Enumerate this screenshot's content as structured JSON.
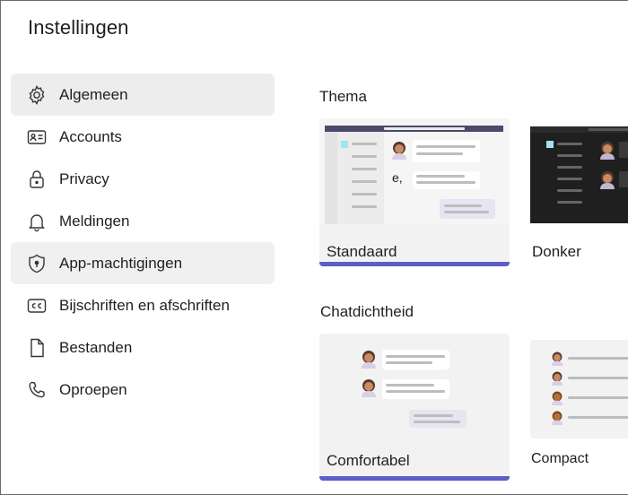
{
  "window": {
    "title": "Instellingen"
  },
  "sidebar": {
    "items": [
      {
        "label": "Algemeen",
        "icon": "gear-icon",
        "state": "selected"
      },
      {
        "label": "Accounts",
        "icon": "id-card-icon"
      },
      {
        "label": "Privacy",
        "icon": "lock-icon"
      },
      {
        "label": "Meldingen",
        "icon": "bell-icon"
      },
      {
        "label": "App-machtigingen",
        "icon": "shield-icon",
        "state": "hover"
      },
      {
        "label": "Bijschriften en afschriften",
        "icon": "closed-captions-icon"
      },
      {
        "label": "Bestanden",
        "icon": "file-icon"
      },
      {
        "label": "Oproepen",
        "icon": "phone-icon"
      }
    ]
  },
  "theme": {
    "heading": "Thema",
    "options": [
      {
        "label": "Standaard",
        "selected": true,
        "preview_text": "e,"
      },
      {
        "label": "Donker",
        "selected": false
      }
    ]
  },
  "density": {
    "heading": "Chatdichtheid",
    "options": [
      {
        "label": "Comfortabel",
        "selected": true
      },
      {
        "label": "Compact",
        "selected": false
      }
    ]
  },
  "colors": {
    "accent": "#5b5fc7",
    "selected_bg": "#ededed",
    "card_bg": "#f2f2f2",
    "dark_preview_bg": "#1f1f1f"
  }
}
